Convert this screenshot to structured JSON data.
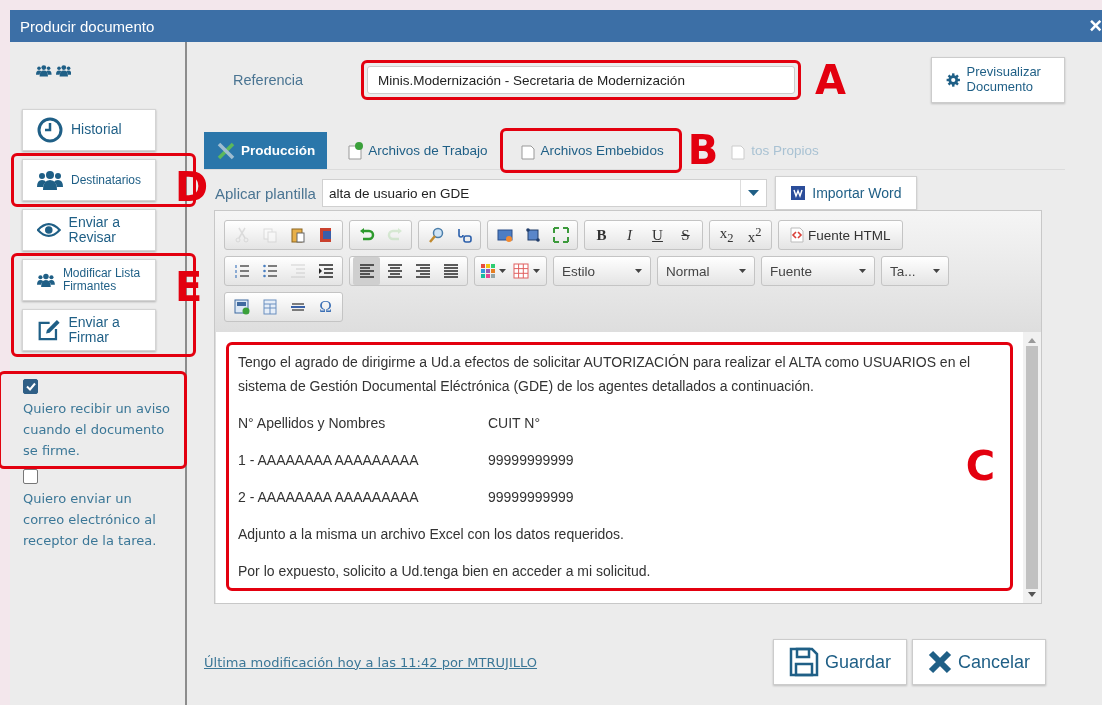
{
  "window": {
    "title": "Producir documento",
    "close": "×"
  },
  "sidebar": {
    "groups": [
      {
        "buttons": [
          {
            "kind": "history",
            "label": "Historial",
            "small": false
          }
        ]
      },
      {
        "highlighted": true,
        "callout": "D",
        "buttons": [
          {
            "kind": "people",
            "label": "Destinatarios",
            "small": true
          }
        ]
      },
      {
        "buttons": [
          {
            "kind": "eye",
            "label": "Enviar a Revisar",
            "small": false
          }
        ]
      },
      {
        "highlighted": true,
        "callout": "E",
        "buttons": [
          {
            "kind": "people",
            "label": "Modificar Lista Firmantes",
            "small": true
          },
          {
            "kind": "edit",
            "label": "Enviar a Firmar",
            "small": false
          }
        ]
      }
    ],
    "checkboxes": [
      {
        "label": "Quiero recibir un aviso cuando el documento se firme.",
        "checked": true,
        "highlighted": true
      },
      {
        "label": "Quiero enviar un correo electrónico al receptor de la tarea.",
        "checked": false
      }
    ]
  },
  "reference": {
    "label": "Referencia",
    "value": "Minis.Modernización - Secretaria de Modernización",
    "highlighted": true,
    "callout": "A"
  },
  "preview_button": "Previsualizar Documento",
  "tabs": [
    {
      "label": "Producción",
      "selected": true,
      "disabled": false
    },
    {
      "label": "Archivos de Trabajo",
      "selected": false,
      "disabled": false
    },
    {
      "label": "Archivos Embebidos",
      "selected": false,
      "disabled": false,
      "highlighted": true,
      "callout": "B"
    },
    {
      "label": "tos Propios",
      "selected": false,
      "disabled": true
    }
  ],
  "template": {
    "label": "Aplicar plantilla",
    "value": "alta de usuario en GDE"
  },
  "import_word": "Importar Word",
  "toolbar": {
    "icon_groups": [
      [
        {
          "kind": "cut",
          "disabled": true
        },
        {
          "kind": "copy",
          "disabled": true
        },
        {
          "kind": "paste",
          "disabled": false
        },
        {
          "kind": "paste-word",
          "disabled": false
        }
      ],
      [
        {
          "kind": "undo",
          "disabled": false
        },
        {
          "kind": "redo",
          "disabled": true
        }
      ],
      [
        {
          "kind": "find",
          "disabled": false
        },
        {
          "kind": "replace",
          "disabled": false
        }
      ],
      [
        {
          "kind": "image",
          "disabled": false
        },
        {
          "kind": "frame",
          "disabled": false
        },
        {
          "kind": "maximize",
          "disabled": false
        }
      ]
    ],
    "format_buttons": [
      "B",
      "I",
      "U",
      "S"
    ],
    "script_buttons": [
      "x$_{2}$",
      "x$^{2}$"
    ],
    "source_button": "Fuente HTML",
    "list_buttons": [
      {
        "kind": "numbered",
        "disabled": false
      },
      {
        "kind": "bulleted",
        "disabled": false
      },
      {
        "kind": "outdent",
        "disabled": true
      },
      {
        "kind": "indent",
        "disabled": false
      }
    ],
    "align_buttons": [
      {
        "kind": "left",
        "selected": true
      },
      {
        "kind": "center",
        "selected": false
      },
      {
        "kind": "right",
        "selected": false
      },
      {
        "kind": "justify",
        "selected": false
      }
    ],
    "dropdowns": [
      "Estilo",
      "Normal",
      "Fuente",
      "Ta..."
    ],
    "extra_icons": [
      {
        "kind": "template"
      },
      {
        "kind": "table"
      },
      {
        "kind": "rule"
      }
    ],
    "special_char": "Ω"
  },
  "document": {
    "highlighted": true,
    "callout": "C",
    "blocks": [
      {
        "kind": "text",
        "text": "Tengo el agrado de dirigirme a Ud.a efectos de solicitar AUTORIZACIÓN para realizar el ALTA como USUARIOS en el sistema de Gestión Documental Eléctrónica (GDE) de los agentes detallados a continuación."
      },
      {
        "kind": "row",
        "cells": [
          "N° Apellidos y Nombres",
          "CUIT N°"
        ]
      },
      {
        "kind": "row",
        "cells": [
          "1 - AAAAAAAA AAAAAAAAA",
          "99999999999"
        ]
      },
      {
        "kind": "row",
        "cells": [
          "2 - AAAAAAAA AAAAAAAAA",
          "99999999999"
        ]
      },
      {
        "kind": "text",
        "text": "Adjunto a la misma un archivo Excel con los datos requeridos."
      },
      {
        "kind": "text",
        "text": "Por lo expuesto, solicito a Ud.tenga bien en acceder a mi solicitud."
      }
    ]
  },
  "footer": {
    "last_modified": "Última modificación hoy a las 11:42 por MTRUJILLO",
    "buttons": [
      {
        "kind": "save",
        "label": "Guardar"
      },
      {
        "kind": "cancel",
        "label": "Cancelar"
      }
    ]
  }
}
